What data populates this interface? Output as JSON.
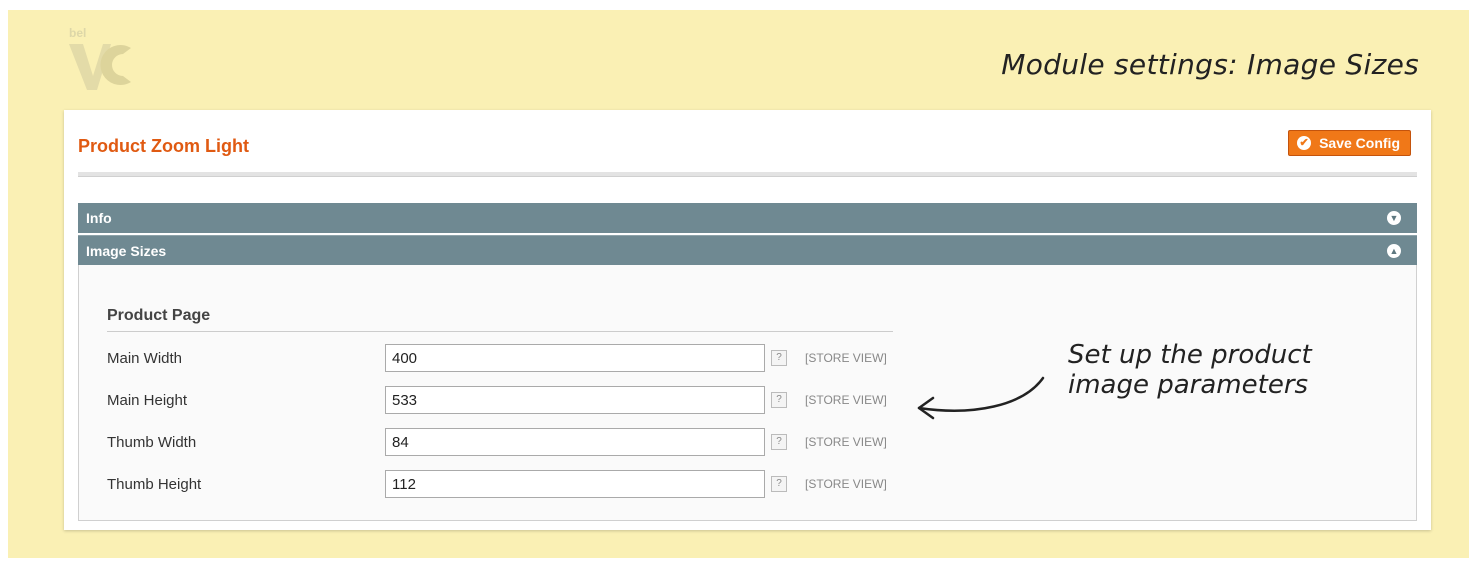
{
  "headline": "Module settings: Image Sizes",
  "logo": {
    "text": "bel",
    "icon": "vc-logo-icon"
  },
  "panel": {
    "title": "Product Zoom Light",
    "save_label": "Save Config",
    "save_icon": "check-circle-icon"
  },
  "sections": [
    {
      "label": "Info",
      "state": "collapsed",
      "icon": "chevron-down-icon"
    },
    {
      "label": "Image Sizes",
      "state": "expanded",
      "icon": "chevron-up-icon"
    }
  ],
  "fieldset": {
    "legend": "Product Page",
    "help_glyph": "?",
    "fields": [
      {
        "label": "Main Width",
        "value": "400",
        "scope": "[STORE VIEW]"
      },
      {
        "label": "Main Height",
        "value": "533",
        "scope": "[STORE VIEW]"
      },
      {
        "label": "Thumb Width",
        "value": "84",
        "scope": "[STORE VIEW]"
      },
      {
        "label": "Thumb Height",
        "value": "112",
        "scope": "[STORE VIEW]"
      }
    ]
  },
  "annotation": {
    "line1": "Set up the product",
    "line2": "image parameters"
  },
  "colors": {
    "background": "#faf0b4",
    "accent": "#e05a12",
    "button": "#f07818",
    "section_bar": "#6f8992"
  }
}
